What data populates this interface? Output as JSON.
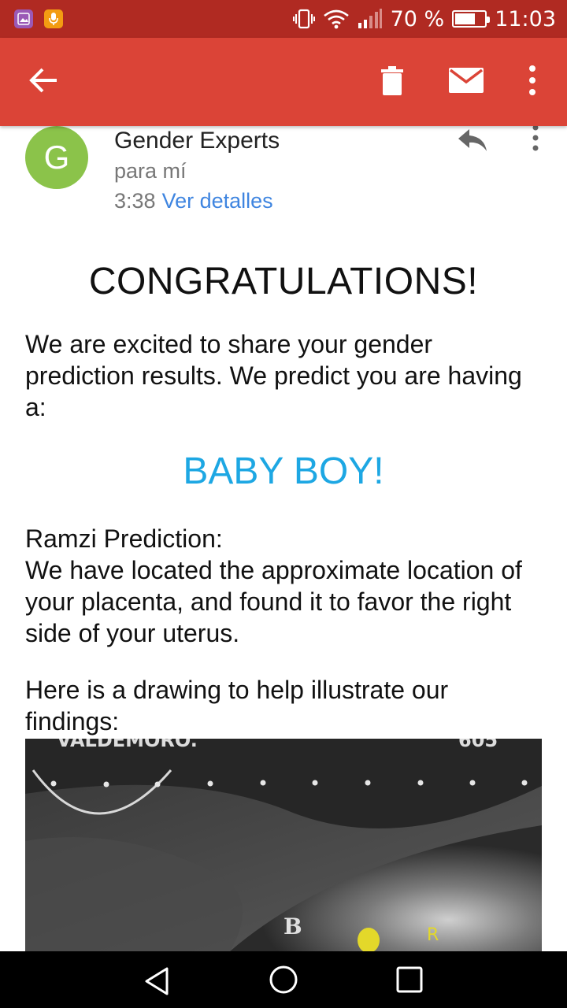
{
  "status_bar": {
    "battery_percent": "70 %",
    "battery_level": 0.7,
    "time": "11:03",
    "icons": [
      "gallery-notification-icon",
      "audio-notification-icon",
      "vibrate-icon",
      "wifi-icon",
      "signal-icon",
      "battery-icon"
    ]
  },
  "app_bar": {
    "icons": [
      "back-arrow-icon",
      "trash-icon",
      "mail-icon",
      "more-vert-icon"
    ],
    "color": "#db4437"
  },
  "sender": {
    "avatar_letter": "G",
    "avatar_color": "#8bc34a",
    "name": "Gender Experts",
    "to": "para mí",
    "time": "3:38",
    "details_link": "Ver detalles"
  },
  "body": {
    "heading": "CONGRATULATIONS!",
    "intro": "We are excited to share your gender prediction results. We predict you are having a:",
    "result": "BABY BOY!",
    "result_color": "#1da7e3",
    "ramzi_title": "Ramzi Prediction:",
    "ramzi_text": "We have located the approximate location of your placenta, and found it to favor the right side of your uterus.",
    "drawing_intro": "Here is a drawing to help illustrate our findings:",
    "image_labels": {
      "top_left": "VALDEMORO.",
      "top_right": "605",
      "marker_b": "B",
      "marker_r": "R"
    }
  },
  "nav_bar": {
    "icons": [
      "nav-back-icon",
      "nav-home-icon",
      "nav-recent-icon"
    ]
  }
}
